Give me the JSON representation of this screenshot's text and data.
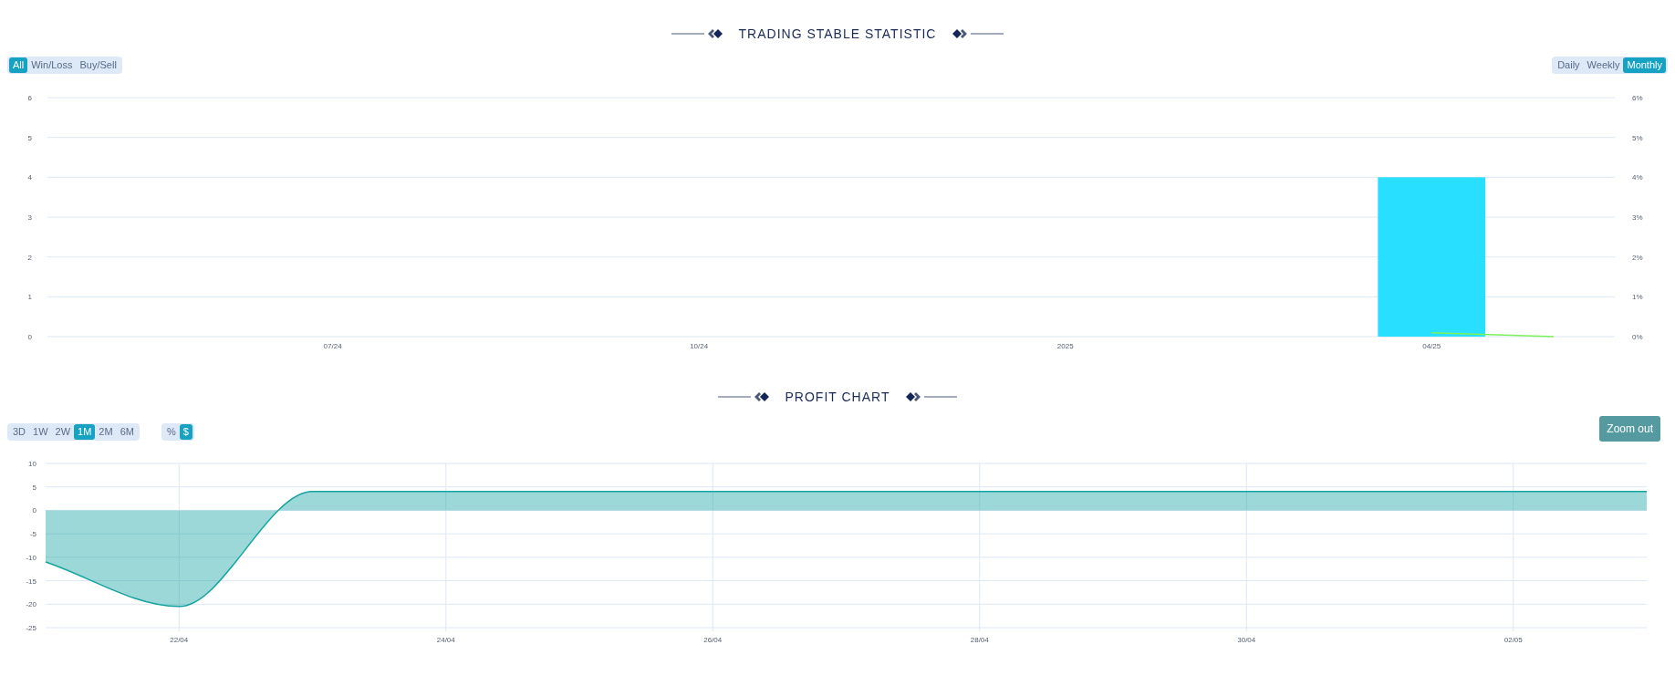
{
  "statistic": {
    "title": "TRADING STABLE STATISTIC",
    "filters": [
      {
        "label": "All",
        "selected": true
      },
      {
        "label": "Win/Loss",
        "selected": false
      },
      {
        "label": "Buy/Sell",
        "selected": false
      }
    ],
    "periods": [
      {
        "label": "Daily",
        "selected": false
      },
      {
        "label": "Weekly",
        "selected": false
      },
      {
        "label": "Monthly",
        "selected": true
      }
    ],
    "chart_data": {
      "type": "bar",
      "categories": [
        null,
        null,
        "07/24",
        null,
        null,
        "10/24",
        null,
        null,
        "2025",
        null,
        null,
        "04/25",
        null
      ],
      "ylim": [
        0,
        6
      ],
      "y2lim": [
        0,
        6
      ],
      "grid": true,
      "yticks": [
        0,
        1,
        2,
        3,
        4,
        5,
        6
      ],
      "y2ticks": [
        {
          "value": 0,
          "label": "0%"
        },
        {
          "value": 1,
          "label": "1%"
        },
        {
          "value": 2,
          "label": "2%"
        },
        {
          "value": 3,
          "label": "3%"
        },
        {
          "value": 4,
          "label": "4%"
        },
        {
          "value": 5,
          "label": "5%"
        },
        {
          "value": 6,
          "label": "6%"
        }
      ],
      "series": [
        {
          "color": "#29dfff",
          "values": [
            null,
            null,
            null,
            null,
            null,
            null,
            null,
            null,
            null,
            null,
            null,
            4,
            null
          ]
        },
        {
          "type": "line",
          "color": "#7cf05a",
          "values": [
            null,
            null,
            null,
            null,
            null,
            null,
            null,
            null,
            null,
            null,
            null,
            0.1,
            0
          ]
        }
      ]
    }
  },
  "profit": {
    "title": "PROFIT CHART",
    "ranges": [
      {
        "label": "3D",
        "selected": false
      },
      {
        "label": "1W",
        "selected": false
      },
      {
        "label": "2W",
        "selected": false
      },
      {
        "label": "1M",
        "selected": true
      },
      {
        "label": "2M",
        "selected": false
      },
      {
        "label": "6M",
        "selected": false
      }
    ],
    "units": [
      {
        "label": "%",
        "selected": false
      },
      {
        "label": "$",
        "selected": true
      }
    ],
    "zoom_button": "Zoom out",
    "chart_data": {
      "type": "area",
      "categories": [
        null,
        "22/04",
        null,
        "24/04",
        null,
        "26/04",
        null,
        "28/04",
        null,
        "30/04",
        null,
        "02/05",
        null
      ],
      "ylim": [
        -25,
        10
      ],
      "grid": true,
      "yticks": [
        -25,
        -20,
        -15,
        -10,
        -5,
        0,
        5,
        10
      ],
      "series": [
        {
          "color": "#14a3a0",
          "values": [
            -11,
            -20.5,
            4,
            4,
            4,
            4,
            4,
            4,
            4,
            4,
            4,
            4,
            4
          ]
        }
      ]
    }
  }
}
